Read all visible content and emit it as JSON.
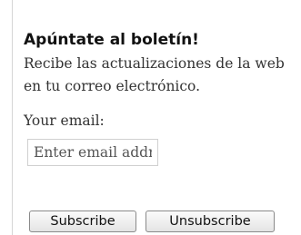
{
  "newsletter": {
    "title": "Apúntate al boletín!",
    "description": "Recibe las actualizaciones de la web en tu correo electrónico.",
    "email_label": "Your email:",
    "email_placeholder": "Enter email address",
    "email_value": "",
    "subscribe_label": "Subscribe",
    "unsubscribe_label": "Unsubscribe"
  }
}
